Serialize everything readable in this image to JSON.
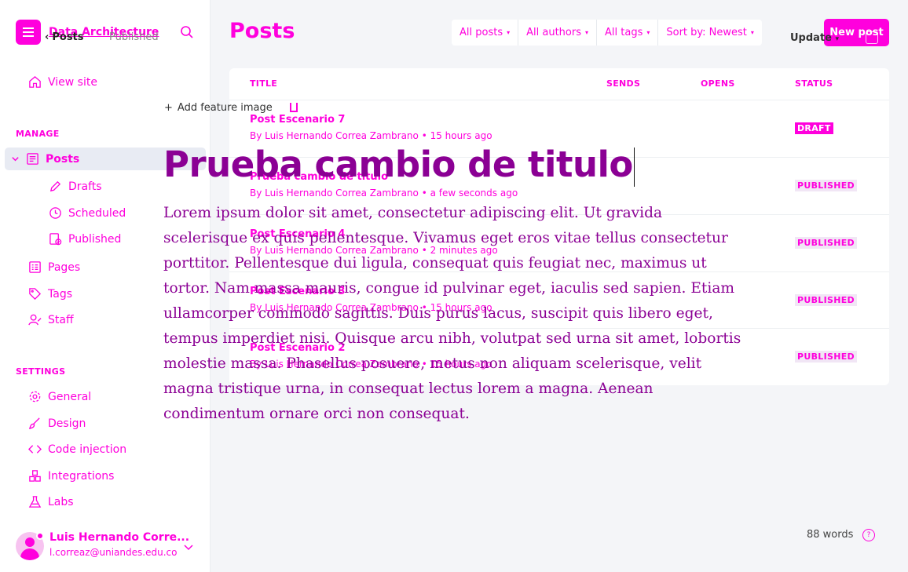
{
  "brand": {
    "name": "Data Architecture"
  },
  "sidebar": {
    "view_site": "View site",
    "manage_label": "MANAGE",
    "settings_label": "SETTINGS",
    "manage_items": [
      {
        "label": "Posts"
      },
      {
        "label": "Drafts"
      },
      {
        "label": "Scheduled"
      },
      {
        "label": "Published"
      },
      {
        "label": "Pages"
      },
      {
        "label": "Tags"
      },
      {
        "label": "Staff"
      }
    ],
    "settings_items": [
      {
        "label": "General"
      },
      {
        "label": "Design"
      },
      {
        "label": "Code injection"
      },
      {
        "label": "Integrations"
      },
      {
        "label": "Labs"
      }
    ],
    "user": {
      "name": "Luis Hernando Corre...",
      "email": "l.correaz@uniandes.edu.co"
    }
  },
  "header": {
    "title": "Posts",
    "filters": [
      "All posts",
      "All authors",
      "All tags",
      "Sort by: Newest"
    ],
    "new_post": "New post"
  },
  "table": {
    "columns": [
      "TITLE",
      "SENDS",
      "OPENS",
      "STATUS"
    ],
    "rows": [
      {
        "title": "Post Escenario 7",
        "meta": "By Luis Hernando Correa Zambrano • 15 hours ago",
        "status": "DRAFT"
      },
      {
        "title": "Prueba cambio de titulo",
        "meta": "By Luis Hernando Correa Zambrano • a few seconds ago",
        "status": "PUBLISHED"
      },
      {
        "title": "Post Escenario 4",
        "meta": "By Luis Hernando Correa Zambrano • 2 minutes ago",
        "status": "PUBLISHED"
      },
      {
        "title": "Post Escenario 3",
        "meta": "By Luis Hernando Correa Zambrano • 15 hours ago",
        "status": "PUBLISHED"
      },
      {
        "title": "Post Escenario 2",
        "meta": "By Luis Hernando Correa Zambrano • 15 hours ago",
        "status": "PUBLISHED"
      }
    ]
  },
  "editor": {
    "back_label": "Posts",
    "status": "Published",
    "add_feature_image": "Add feature image",
    "title": "Prueba cambio de titulo",
    "body": "Lorem ipsum dolor sit amet, consectetur adipiscing elit. Ut gravida scelerisque ex quis pellentesque. Vivamus eget eros vitae tellus consectetur porttitor. Pellentesque dui ligula, consequat quis feugiat nec, maximus ut tortor. Nam massa mauris, congue id pulvinar eget, iaculis sed sapien. Etiam ullamcorper commodo sagittis. Duis purus lacus, suscipit quis libero eget, tempus imperdiet nisi. Quisque arcu nibh, volutpat sed urna sit amet, lobortis molestie massa. Phasellus posuere, metus non aliquam scelerisque, velit magna tristique urna, in consequat lectus lorem a magna. Aenean condimentum ornare orci non consequat.",
    "update_label": "Update",
    "word_count": "88 words"
  },
  "colors": {
    "accent": "#ff00dd",
    "title": "#8b0094",
    "sidebar_active": "#e8ebf3"
  }
}
